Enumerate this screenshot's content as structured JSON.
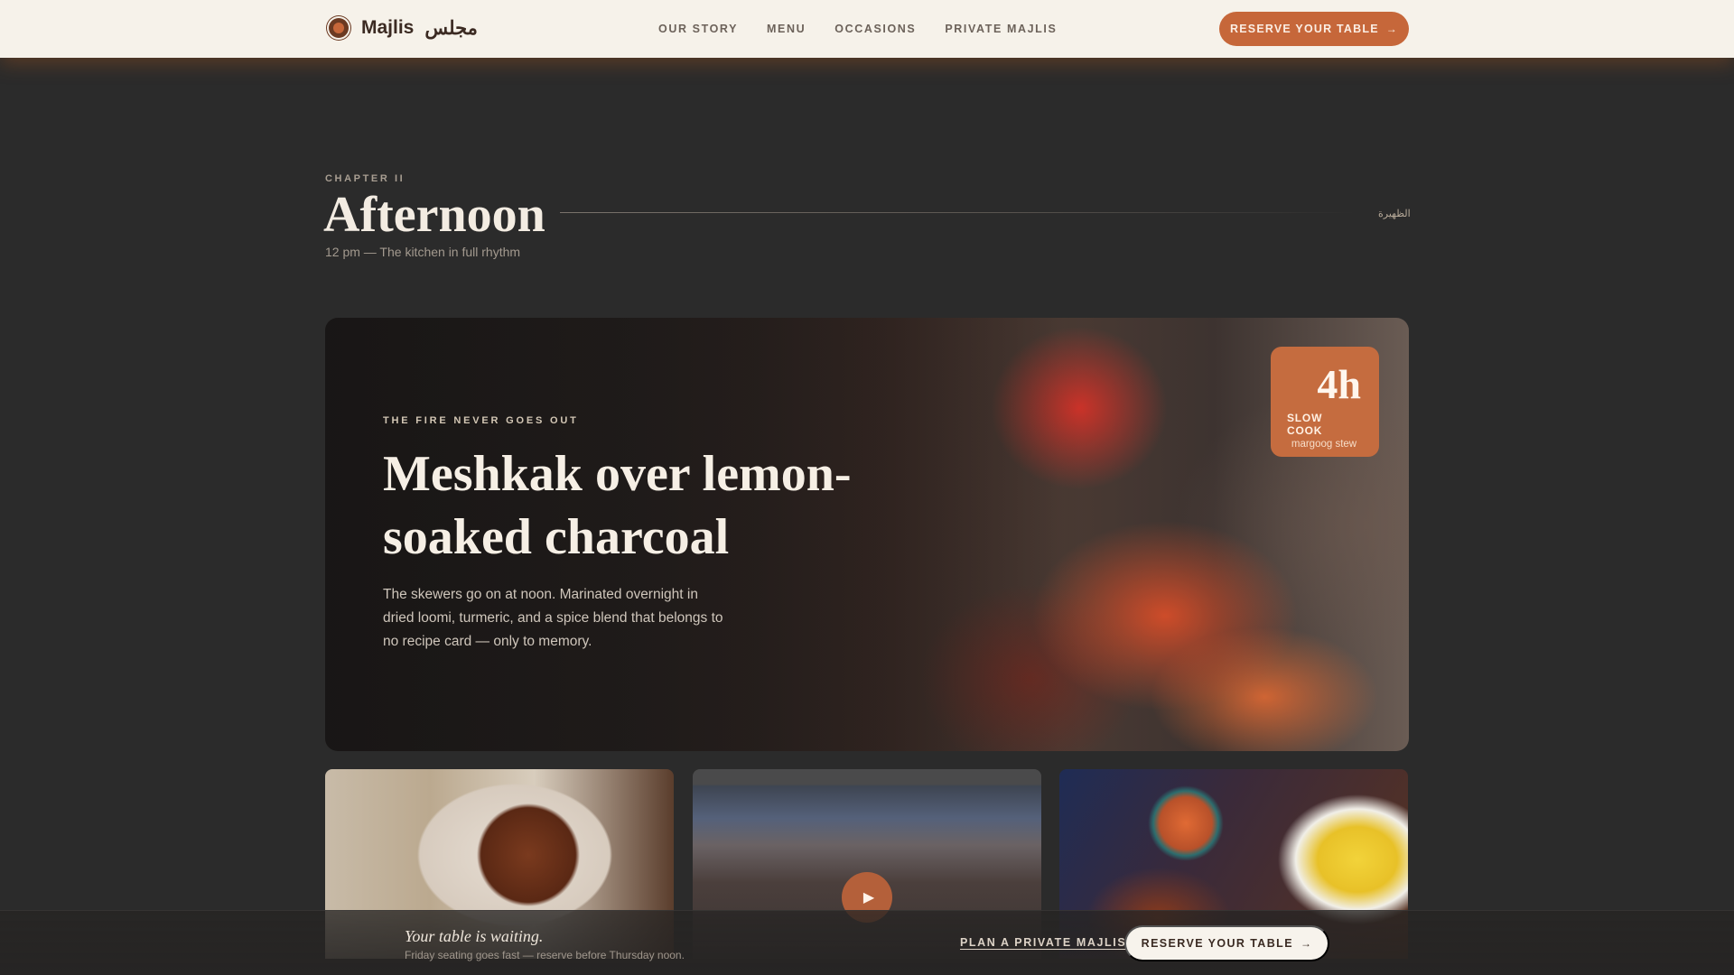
{
  "nav": {
    "brand_name": "Majlis",
    "brand_arabic": "مجلس",
    "links": [
      "OUR STORY",
      "MENU",
      "OCCASIONS",
      "PRIVATE MAJLIS"
    ],
    "cta_label": "RESERVE YOUR TABLE",
    "cta_arrow": "→"
  },
  "chapter": {
    "label": "CHAPTER II",
    "title": "Afternoon",
    "arabic": "الظهيرة",
    "subtitle": "12 pm — The kitchen in full rhythm"
  },
  "hero": {
    "kicker": "THE FIRE NEVER GOES OUT",
    "title": "Meshkak over lemon-soaked charcoal",
    "body": "The skewers go on at noon. Marinated overnight in dried loomi, turmeric, and a spice blend that belongs to no recipe card — only to memory.",
    "badge": {
      "value": "4h",
      "label": "SLOW COOK",
      "sub": "margoog stew"
    }
  },
  "cards": {
    "play_glyph": "▶"
  },
  "bottom_bar": {
    "title": "Your table is waiting.",
    "subtitle": "Friday seating goes fast — reserve before Thursday noon.",
    "link_label": "PLAN A PRIVATE MAJLIS",
    "cta_label": "RESERVE YOUR TABLE",
    "cta_arrow": "→"
  },
  "colors": {
    "accent": "#c6673a",
    "nav_bg": "#f6f2ea",
    "page_bg": "#2b2b2b"
  }
}
